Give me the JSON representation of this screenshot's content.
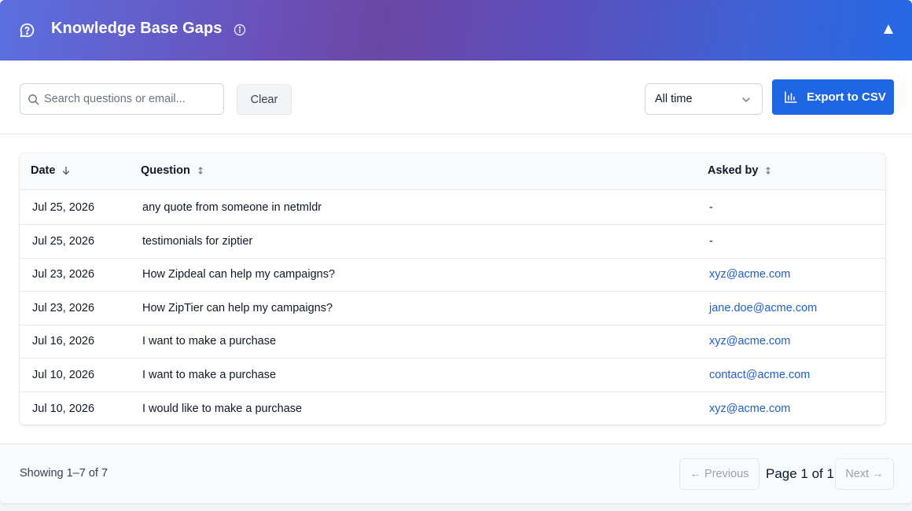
{
  "header": {
    "title": "Knowledge Base Gaps",
    "icon": "question-circle-icon",
    "info_icon": "info-icon",
    "collapse_icon": "triangle-up-icon",
    "gradient_colors": [
      "#5b6fe0",
      "#6b47a5",
      "#2568e6"
    ]
  },
  "toolbar": {
    "search_placeholder": "Search questions or email...",
    "search_value": "",
    "clear_label": "Clear",
    "range_selected": "All time",
    "export_label": "Export to CSV",
    "accent": "#1f66e5"
  },
  "table": {
    "columns": [
      {
        "label": "Date",
        "sort": "desc"
      },
      {
        "label": "Question",
        "sort": "none"
      },
      {
        "label": "Asked by",
        "sort": "none"
      }
    ],
    "rows": [
      {
        "date": "Jul 25, 2026",
        "question": "any quote from someone in netmldr",
        "asked_by": "-"
      },
      {
        "date": "Jul 25, 2026",
        "question": "testimonials for ziptier",
        "asked_by": "-"
      },
      {
        "date": "Jul 23, 2026",
        "question": "How Zipdeal can help my campaigns?",
        "asked_by": "xyz@acme.com"
      },
      {
        "date": "Jul 23, 2026",
        "question": "How ZipTier can help my campaigns?",
        "asked_by": "jane.doe@acme.com"
      },
      {
        "date": "Jul 16, 2026",
        "question": "I want to make a purchase",
        "asked_by": "xyz@acme.com"
      },
      {
        "date": "Jul 10, 2026",
        "question": "I want to make a purchase",
        "asked_by": "contact@acme.com"
      },
      {
        "date": "Jul 10, 2026",
        "question": "I would like to make a purchase",
        "asked_by": "xyz@acme.com"
      }
    ],
    "link_color": "#1d5ed8"
  },
  "footer": {
    "showing": "Showing 1–7 of 7",
    "previous_label": "← Previous",
    "page_info": "Page 1 of 1",
    "next_label": "Next →"
  }
}
